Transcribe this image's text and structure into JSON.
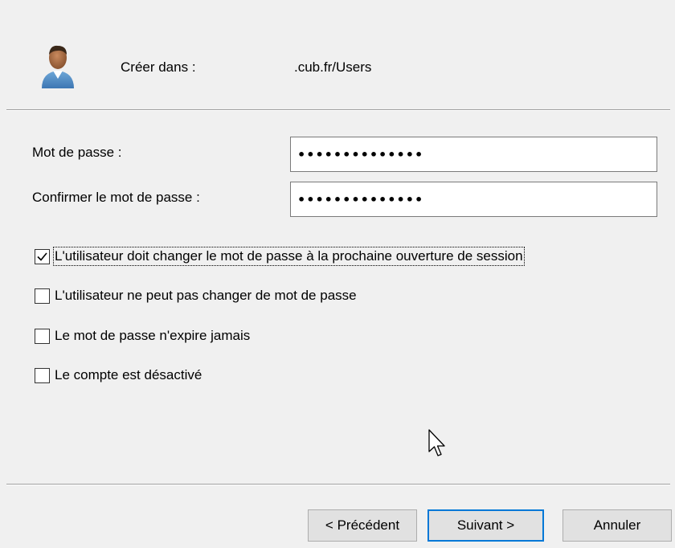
{
  "header": {
    "create_label": "Créer dans :",
    "create_value": ".cub.fr/Users",
    "icon": "user-icon"
  },
  "fields": {
    "password_label": "Mot de passe :",
    "password_value": "••••••••••••••",
    "confirm_label": "Confirmer le mot de passe :",
    "confirm_value": "••••••••••••••"
  },
  "options": [
    {
      "label": "L'utilisateur doit changer le mot de passe à la prochaine ouverture de session",
      "checked": true
    },
    {
      "label": "L'utilisateur ne peut pas changer de mot de passe",
      "checked": false
    },
    {
      "label": "Le mot de passe n'expire jamais",
      "checked": false
    },
    {
      "label": "Le compte est désactivé",
      "checked": false
    }
  ],
  "buttons": {
    "previous": "< Précédent",
    "next": "Suivant >",
    "cancel": "Annuler"
  },
  "colors": {
    "background": "#f0f0f0",
    "focus_border": "#0078d7"
  }
}
